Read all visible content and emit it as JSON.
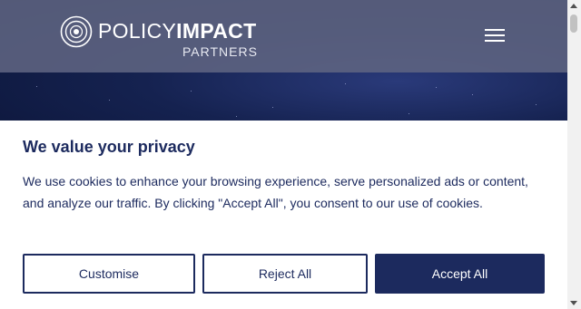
{
  "header": {
    "logo_primary_light": "POLICY",
    "logo_primary_bold": "IMPACT",
    "logo_secondary": "PARTNERS",
    "menu_icon": "hamburger-menu-icon"
  },
  "cookie_banner": {
    "title": "We value your privacy",
    "body": "We use cookies to enhance your browsing experience, serve personalized ads or content, and analyze our traffic. By clicking \"Accept All\", you consent to our use of cookies.",
    "customise_label": "Customise",
    "reject_label": "Reject All",
    "accept_label": "Accept All"
  },
  "colors": {
    "brand_navy": "#1c2a5e",
    "header_bg": "#5f6482",
    "hero_bg": "#152250"
  }
}
